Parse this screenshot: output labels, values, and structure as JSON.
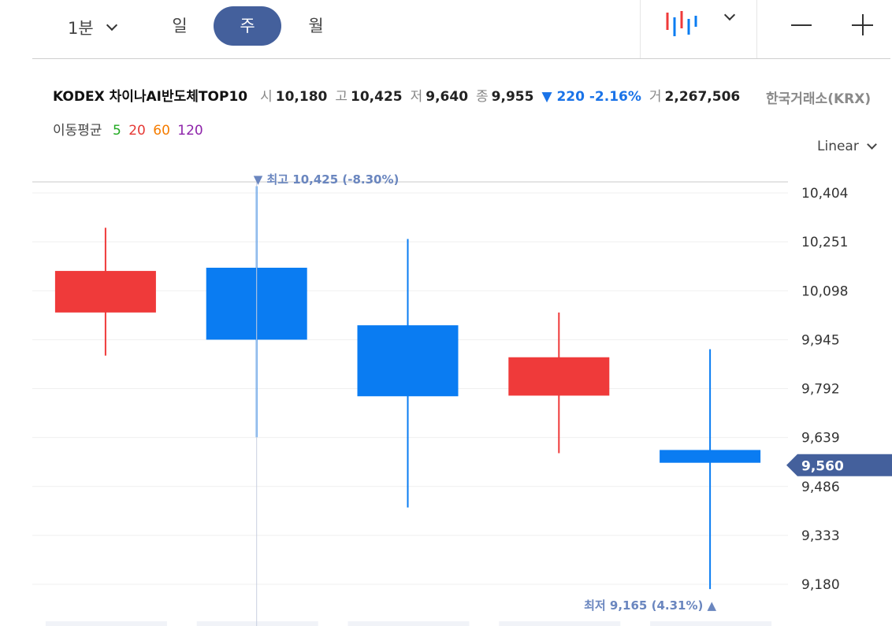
{
  "toolbar": {
    "interval_label": "1분",
    "tabs": [
      {
        "label": "일",
        "selected": false
      },
      {
        "label": "주",
        "selected": true
      },
      {
        "label": "월",
        "selected": false
      }
    ],
    "chart_type_icon": "candlestick-icon",
    "zoom_out_icon": "minus-icon",
    "zoom_in_icon": "plus-icon",
    "accent_color": "#44609c"
  },
  "info": {
    "name": "KODEX 차이나AI반도체TOP10",
    "open_label": "시",
    "open": "10,180",
    "high_label": "고",
    "high": "10,425",
    "low_label": "저",
    "low": "9,640",
    "close_label": "종",
    "close": "9,955",
    "change": "▼ 220 -2.16%",
    "volume_label": "거",
    "volume": "2,267,506",
    "exchange": "한국거래소(KRX)"
  },
  "moving_average": {
    "label": "이동평균",
    "periods": [
      {
        "label": "5",
        "color": "#22aa22"
      },
      {
        "label": "20",
        "color": "#e53935"
      },
      {
        "label": "60",
        "color": "#f57c00"
      },
      {
        "label": "120",
        "color": "#8e24aa"
      }
    ]
  },
  "scale_mode": "Linear",
  "chart_data": {
    "type": "candlestick",
    "y_ticks": [
      "10,404",
      "10,251",
      "10,098",
      "9,945",
      "9,792",
      "9,639",
      "9,486",
      "9,333",
      "9,180"
    ],
    "y_tick_values": [
      10404,
      10251,
      10098,
      9945,
      9792,
      9639,
      9486,
      9333,
      9180
    ],
    "ylim": [
      9135,
      10460
    ],
    "grid": true,
    "up_color": "#ef3a3a",
    "down_color": "#0a7cf2",
    "candles": [
      {
        "open": 10030,
        "close": 10160,
        "high": 10295,
        "low": 9895
      },
      {
        "open": 10170,
        "close": 9945,
        "high": 10425,
        "low": 9640
      },
      {
        "open": 9990,
        "close": 9768,
        "high": 10260,
        "low": 9420
      },
      {
        "open": 9770,
        "close": 9890,
        "high": 10030,
        "low": 9590
      },
      {
        "open": 9600,
        "close": 9560,
        "high": 9915,
        "low": 9165
      }
    ],
    "high_marker": {
      "label": "▼ 최고 10,425 (-8.30%)",
      "value": 10425
    },
    "low_marker": {
      "label": "최저 9,165 (4.31%) ▲",
      "value": 9165
    },
    "current_price": {
      "label": "9,560",
      "value": 9560,
      "color": "#44609c"
    }
  }
}
